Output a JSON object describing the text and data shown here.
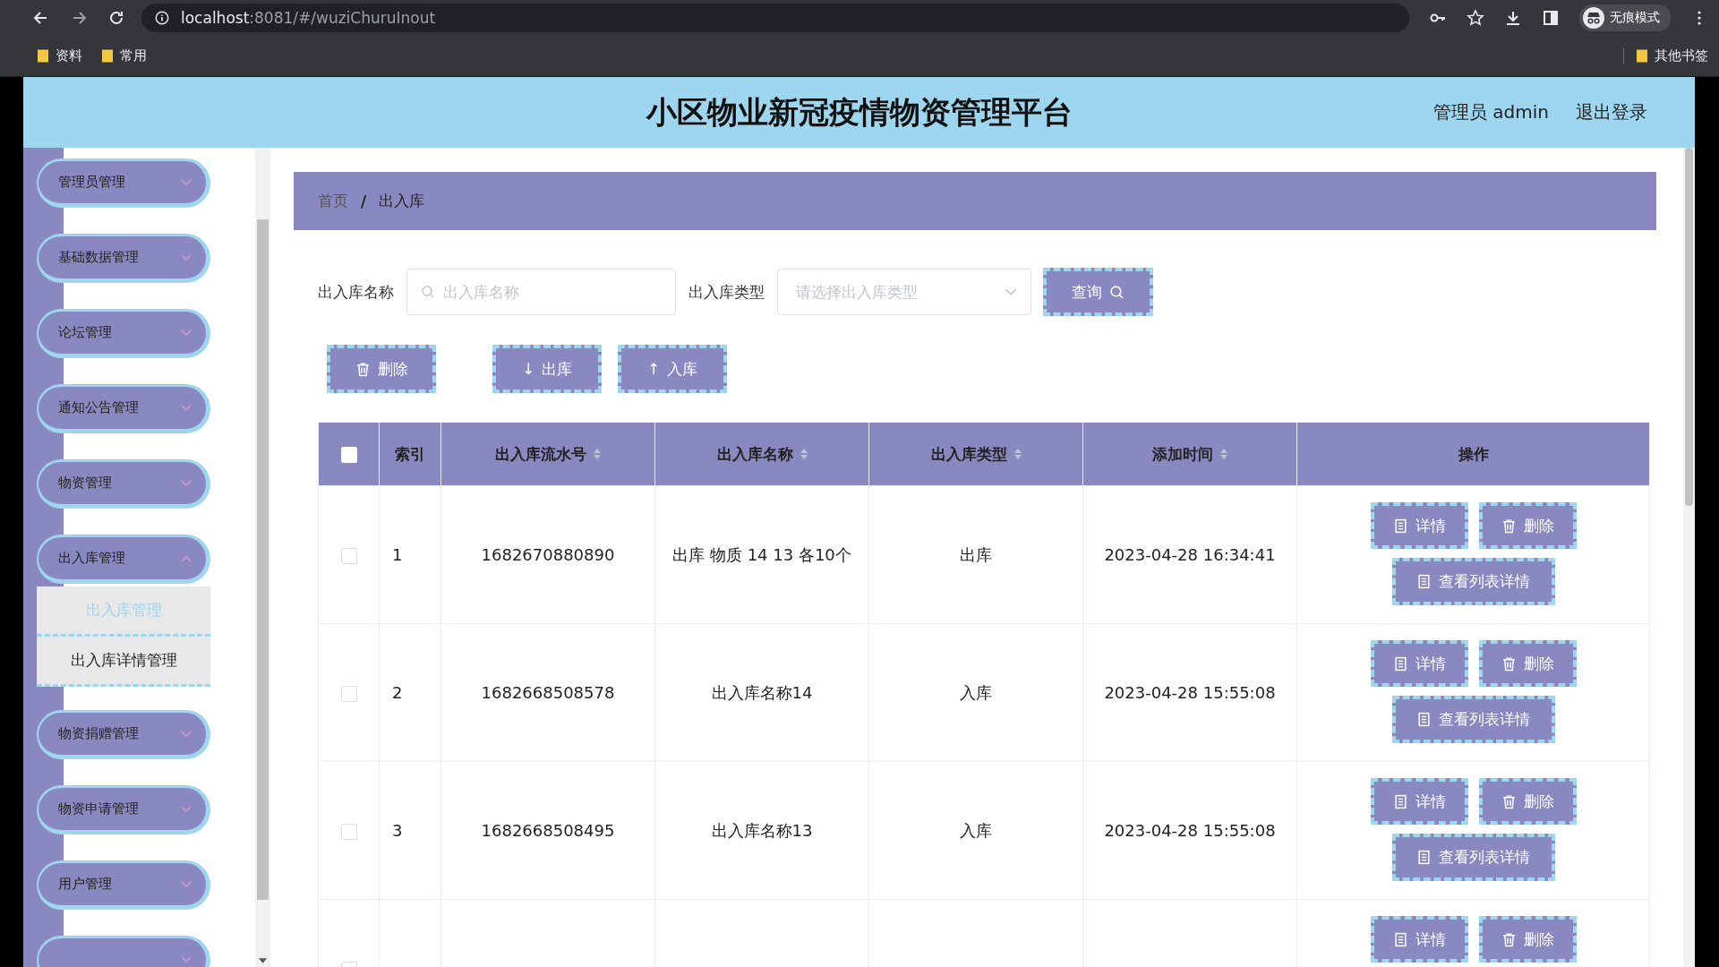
{
  "browser": {
    "url_host": "localhost",
    "url_rest": ":8081/#/wuziChuruInout",
    "profile": "无痕模式",
    "bookmarks": [
      "资料",
      "常用"
    ],
    "other_bookmarks": "其他书签"
  },
  "header": {
    "title": "小区物业新冠疫情物资管理平台",
    "user": "管理员 admin",
    "logout": "退出登录"
  },
  "sidebar": {
    "items": [
      {
        "label": "管理员管理",
        "expanded": false
      },
      {
        "label": "基础数据管理",
        "expanded": false
      },
      {
        "label": "论坛管理",
        "expanded": false
      },
      {
        "label": "通知公告管理",
        "expanded": false
      },
      {
        "label": "物资管理",
        "expanded": false
      },
      {
        "label": "出入库管理",
        "expanded": true,
        "children": [
          {
            "label": "出入库管理",
            "selected": true
          },
          {
            "label": "出入库详情管理",
            "selected": false
          }
        ]
      },
      {
        "label": "物资捐赠管理",
        "expanded": false
      },
      {
        "label": "物资申请管理",
        "expanded": false
      },
      {
        "label": "用户管理",
        "expanded": false
      },
      {
        "expanded": false
      }
    ]
  },
  "breadcrumb": {
    "items": [
      "首页",
      "出入库"
    ],
    "separator": "/"
  },
  "search": {
    "fields": [
      {
        "kind": "text",
        "label": "出入库名称",
        "placeholder": "出入库名称"
      },
      {
        "kind": "select",
        "label": "出入库类型",
        "placeholder": "请选择出入库类型"
      }
    ],
    "query_button": "查询"
  },
  "actions": [
    {
      "kind": "delete",
      "label": "删除"
    },
    {
      "kind": "arrow",
      "glyph": "↓",
      "label": "出库"
    },
    {
      "kind": "arrow",
      "glyph": "↑",
      "label": "入库"
    }
  ],
  "table": {
    "select_all_checked": false,
    "columns": [
      {
        "label": "索引",
        "sortable": false
      },
      {
        "label": "出入库流水号",
        "sortable": true
      },
      {
        "label": "出入库名称",
        "sortable": true
      },
      {
        "label": "出入库类型",
        "sortable": true
      },
      {
        "label": "添加时间",
        "sortable": true
      },
      {
        "label": "操作",
        "sortable": false
      }
    ],
    "rows": [
      {
        "checked": false,
        "index": "1",
        "serial": "1682670880890",
        "name": "出库 物质 14 13 各10个",
        "type": "出库",
        "time": "2023-04-28 16:34:41",
        "actions": [
          {
            "kind": "detail",
            "label": "详情"
          },
          {
            "kind": "delete",
            "label": "删除"
          },
          {
            "kind": "detail",
            "label": "查看列表详情"
          }
        ]
      },
      {
        "checked": false,
        "index": "2",
        "serial": "1682668508578",
        "name": "出入库名称14",
        "type": "入库",
        "time": "2023-04-28 15:55:08",
        "actions": [
          {
            "kind": "detail",
            "label": "详情"
          },
          {
            "kind": "delete",
            "label": "删除"
          },
          {
            "kind": "detail",
            "label": "查看列表详情"
          }
        ]
      },
      {
        "checked": false,
        "index": "3",
        "serial": "1682668508495",
        "name": "出入库名称13",
        "type": "入库",
        "time": "2023-04-28 15:55:08",
        "actions": [
          {
            "kind": "detail",
            "label": "详情"
          },
          {
            "kind": "delete",
            "label": "删除"
          },
          {
            "kind": "detail",
            "label": "查看列表详情"
          }
        ]
      },
      {
        "checked": false,
        "actions": [
          {
            "kind": "detail",
            "label": "详情"
          },
          {
            "kind": "delete",
            "label": "删除"
          }
        ]
      }
    ]
  }
}
